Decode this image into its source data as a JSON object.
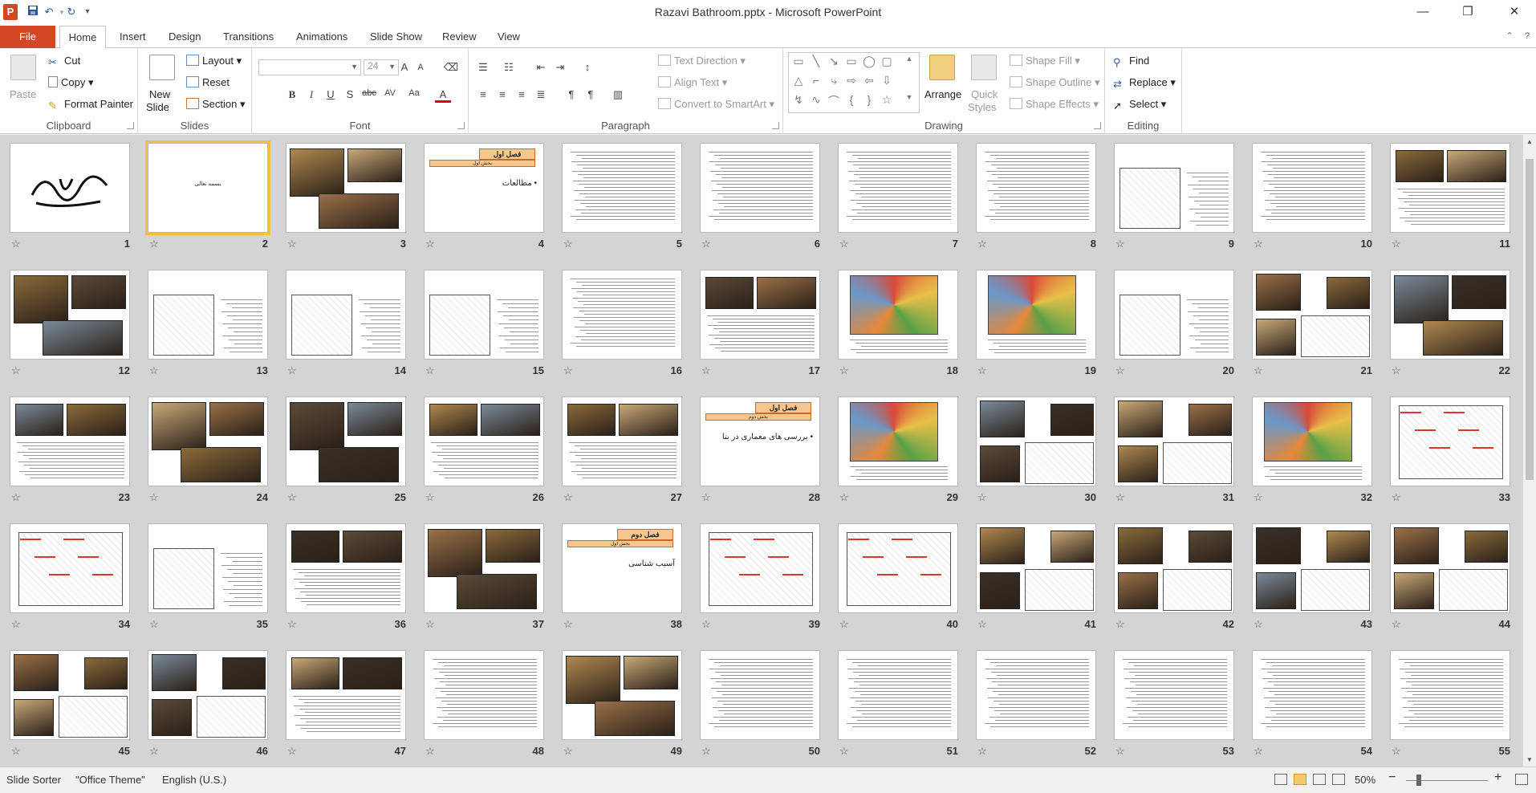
{
  "window": {
    "title": "Razavi Bathroom.pptx  -  Microsoft PowerPoint",
    "minimize": "—",
    "restore": "❐",
    "close": "✕"
  },
  "qat": {
    "app_letter": "P",
    "save_icon": "save-icon",
    "undo_icon": "undo-icon",
    "redo_icon": "redo-icon",
    "customize_icon": "dropdown-icon"
  },
  "tabs": {
    "file": "File",
    "items": [
      "Home",
      "Insert",
      "Design",
      "Transitions",
      "Animations",
      "Slide Show",
      "Review",
      "View"
    ]
  },
  "ribbon": {
    "clipboard": {
      "label": "Clipboard",
      "paste": "Paste",
      "cut": "Cut",
      "copy": "Copy",
      "format_painter": "Format Painter"
    },
    "slides": {
      "label": "Slides",
      "new_slide_line1": "New",
      "new_slide_line2": "Slide",
      "layout": "Layout",
      "reset": "Reset",
      "section": "Section"
    },
    "font": {
      "label": "Font",
      "font_name": "",
      "font_size": "24",
      "bold": "B",
      "italic": "I",
      "underline": "U",
      "shadow": "S",
      "strike": "abc",
      "spacing": "AV",
      "case": "Aa",
      "color": "A",
      "grow": "A",
      "shrink": "A"
    },
    "paragraph": {
      "label": "Paragraph",
      "text_direction": "Text Direction",
      "align_text": "Align Text",
      "convert_smartart": "Convert to SmartArt"
    },
    "drawing": {
      "label": "Drawing",
      "arrange": "Arrange",
      "quick_styles_line1": "Quick",
      "quick_styles_line2": "Styles",
      "shape_fill": "Shape Fill",
      "shape_outline": "Shape Outline",
      "shape_effects": "Shape Effects"
    },
    "editing": {
      "label": "Editing",
      "find": "Find",
      "replace": "Replace",
      "select": "Select"
    }
  },
  "slides": [
    {
      "num": "11",
      "kind": "photos-text"
    },
    {
      "num": "10",
      "kind": "text"
    },
    {
      "num": "9",
      "kind": "map-text"
    },
    {
      "num": "8",
      "kind": "text"
    },
    {
      "num": "7",
      "kind": "text"
    },
    {
      "num": "6",
      "kind": "text"
    },
    {
      "num": "5",
      "kind": "text"
    },
    {
      "num": "4",
      "kind": "chapter",
      "title": "فصل اول",
      "subtitle": "بخش اول",
      "bullet": "• مطالعات"
    },
    {
      "num": "3",
      "kind": "photos"
    },
    {
      "num": "2",
      "kind": "title-only",
      "text": "بسمه تعالی",
      "selected": true
    },
    {
      "num": "1",
      "kind": "calligraphy"
    },
    {
      "num": "22",
      "kind": "photos"
    },
    {
      "num": "21",
      "kind": "photos-map"
    },
    {
      "num": "20",
      "kind": "map-text"
    },
    {
      "num": "19",
      "kind": "colormap"
    },
    {
      "num": "18",
      "kind": "colormap"
    },
    {
      "num": "17",
      "kind": "photos-text"
    },
    {
      "num": "16",
      "kind": "text"
    },
    {
      "num": "15",
      "kind": "map-text"
    },
    {
      "num": "14",
      "kind": "map-text"
    },
    {
      "num": "13",
      "kind": "map-text"
    },
    {
      "num": "12",
      "kind": "photos"
    },
    {
      "num": "33",
      "kind": "plan-red"
    },
    {
      "num": "32",
      "kind": "colormap"
    },
    {
      "num": "31",
      "kind": "photos-map"
    },
    {
      "num": "30",
      "kind": "photos-map"
    },
    {
      "num": "29",
      "kind": "colormap"
    },
    {
      "num": "28",
      "kind": "chapter",
      "title": "فصل اول",
      "subtitle": "بخش دوم",
      "bullet": "• بررسی های معماری در بنا"
    },
    {
      "num": "27",
      "kind": "photos-text"
    },
    {
      "num": "26",
      "kind": "photos-text"
    },
    {
      "num": "25",
      "kind": "photos"
    },
    {
      "num": "24",
      "kind": "photos"
    },
    {
      "num": "23",
      "kind": "photos-text"
    },
    {
      "num": "44",
      "kind": "photos-map"
    },
    {
      "num": "43",
      "kind": "photos-map"
    },
    {
      "num": "42",
      "kind": "photos-map"
    },
    {
      "num": "41",
      "kind": "photos-map"
    },
    {
      "num": "40",
      "kind": "plan-red"
    },
    {
      "num": "39",
      "kind": "plan-red"
    },
    {
      "num": "38",
      "kind": "chapter",
      "title": "فصل دوم",
      "subtitle": "بخش اول",
      "bullet": "آسیب شناسی"
    },
    {
      "num": "37",
      "kind": "photos"
    },
    {
      "num": "36",
      "kind": "photos-text"
    },
    {
      "num": "35",
      "kind": "map-text"
    },
    {
      "num": "34",
      "kind": "plan-red"
    },
    {
      "num": "55",
      "kind": "text"
    },
    {
      "num": "54",
      "kind": "text"
    },
    {
      "num": "53",
      "kind": "text"
    },
    {
      "num": "52",
      "kind": "text"
    },
    {
      "num": "51",
      "kind": "text"
    },
    {
      "num": "50",
      "kind": "text"
    },
    {
      "num": "49",
      "kind": "photos"
    },
    {
      "num": "48",
      "kind": "text"
    },
    {
      "num": "47",
      "kind": "photos-text"
    },
    {
      "num": "46",
      "kind": "photos-map"
    },
    {
      "num": "45",
      "kind": "photos-map"
    }
  ],
  "statusbar": {
    "view_name": "Slide Sorter",
    "theme": "\"Office Theme\"",
    "language": "English (U.S.)",
    "zoom": "50%",
    "zoom_out": "−",
    "zoom_in": "+"
  }
}
